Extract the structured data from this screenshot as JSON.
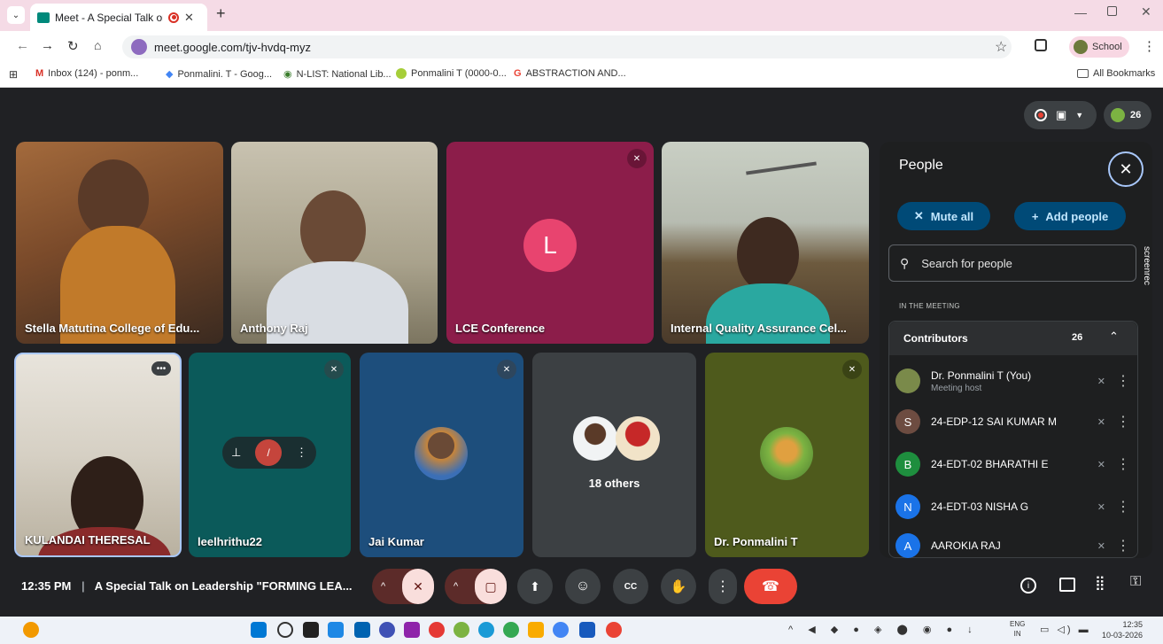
{
  "browser": {
    "tab_title": "Meet - A Special Talk on Le",
    "url": "meet.google.com/tjv-hvdq-myz",
    "profile_label": "School",
    "bookmarks": [
      "Inbox (124) - ponm...",
      "Ponmalini. T - Goog...",
      "N-LIST: National Lib...",
      "Ponmalini T (0000-0...",
      "ABSTRACTION AND..."
    ],
    "all_bookmarks_label": "All Bookmarks"
  },
  "meet": {
    "participant_count_badge": "26",
    "tiles": [
      {
        "name": "Stella Matutina College of Edu..."
      },
      {
        "name": "Anthony Raj"
      },
      {
        "name": "LCE Conference",
        "avatar_letter": "L"
      },
      {
        "name": "Internal Quality Assurance Cel..."
      },
      {
        "name": "KULANDAI THERESAL"
      },
      {
        "name": "leelhrithu22"
      },
      {
        "name": "Jai Kumar"
      },
      {
        "name": "18 others"
      },
      {
        "name": "Dr. Ponmalini T"
      }
    ],
    "people_panel": {
      "title": "People",
      "mute_all_label": "Mute all",
      "add_people_label": "Add people",
      "search_placeholder": "Search for people",
      "section_label": "IN THE MEETING",
      "group_label": "Contributors",
      "group_count": "26",
      "participants": [
        {
          "initial": "",
          "name": "Dr. Ponmalini T (You)",
          "subtitle": "Meeting host",
          "color": "#7a8a4a"
        },
        {
          "initial": "S",
          "name": "24-EDP-12 SAI KUMAR M",
          "subtitle": "",
          "color": "#6d4c41"
        },
        {
          "initial": "B",
          "name": "24-EDT-02 BHARATHI E",
          "subtitle": "",
          "color": "#1e8e3e"
        },
        {
          "initial": "N",
          "name": "24-EDT-03 NISHA G",
          "subtitle": "",
          "color": "#1a73e8"
        },
        {
          "initial": "A",
          "name": "AAROKIA RAJ",
          "subtitle": "",
          "color": "#1a73e8"
        }
      ],
      "watermark": "screenrec"
    },
    "time": "12:35 PM",
    "meeting_title": "A Special Talk on Leadership \"FORMING LEA..."
  },
  "taskbar": {
    "lang": "ENG",
    "lang_region": "IN",
    "clock_time": "12:35",
    "clock_date": "10-03-2026"
  },
  "colors": {
    "accent_red": "#ea4335",
    "panel_button": "#004a77",
    "lce_tile": "#8c1d4a",
    "tile_teal": "#0b5a5a",
    "tile_blue": "#1d4e7c",
    "tile_olive": "#4e5a1c"
  }
}
